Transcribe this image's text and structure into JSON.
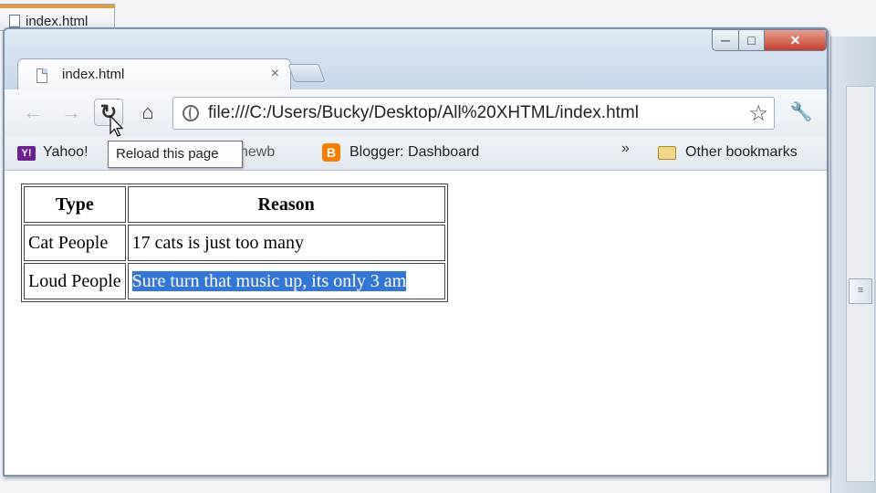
{
  "background": {
    "taskbar_label": "index.html"
  },
  "window": {
    "controls": {
      "minimize": "─",
      "maximize": "□",
      "close": "✕"
    }
  },
  "tab": {
    "title": "index.html",
    "close": "×"
  },
  "toolbar": {
    "back_icon": "←",
    "forward_icon": "→",
    "reload_icon": "↻",
    "home_icon": "⌂",
    "url": "file:///C:/Users/Bucky/Desktop/All%20XHTML/index.html",
    "star_icon": "☆",
    "wrench_icon": "🔧"
  },
  "bookmarks": {
    "items": [
      {
        "label": "Yahoo!",
        "icon": "Y!"
      },
      {
        "label": "newb"
      },
      {
        "label": "Blogger: Dashboard",
        "icon": "B"
      }
    ],
    "overflow": "»",
    "other": "Other bookmarks"
  },
  "tooltip": "Reload this page",
  "table": {
    "headers": [
      "Type",
      "Reason"
    ],
    "rows": [
      [
        "Cat People",
        "17 cats is just too many"
      ],
      [
        "Loud People",
        "Sure turn that music up, its only 3 am"
      ]
    ]
  },
  "colors": {
    "selection": "#3476d6",
    "window_frame": "#7d93ad",
    "close_button": "#c33f2b"
  }
}
